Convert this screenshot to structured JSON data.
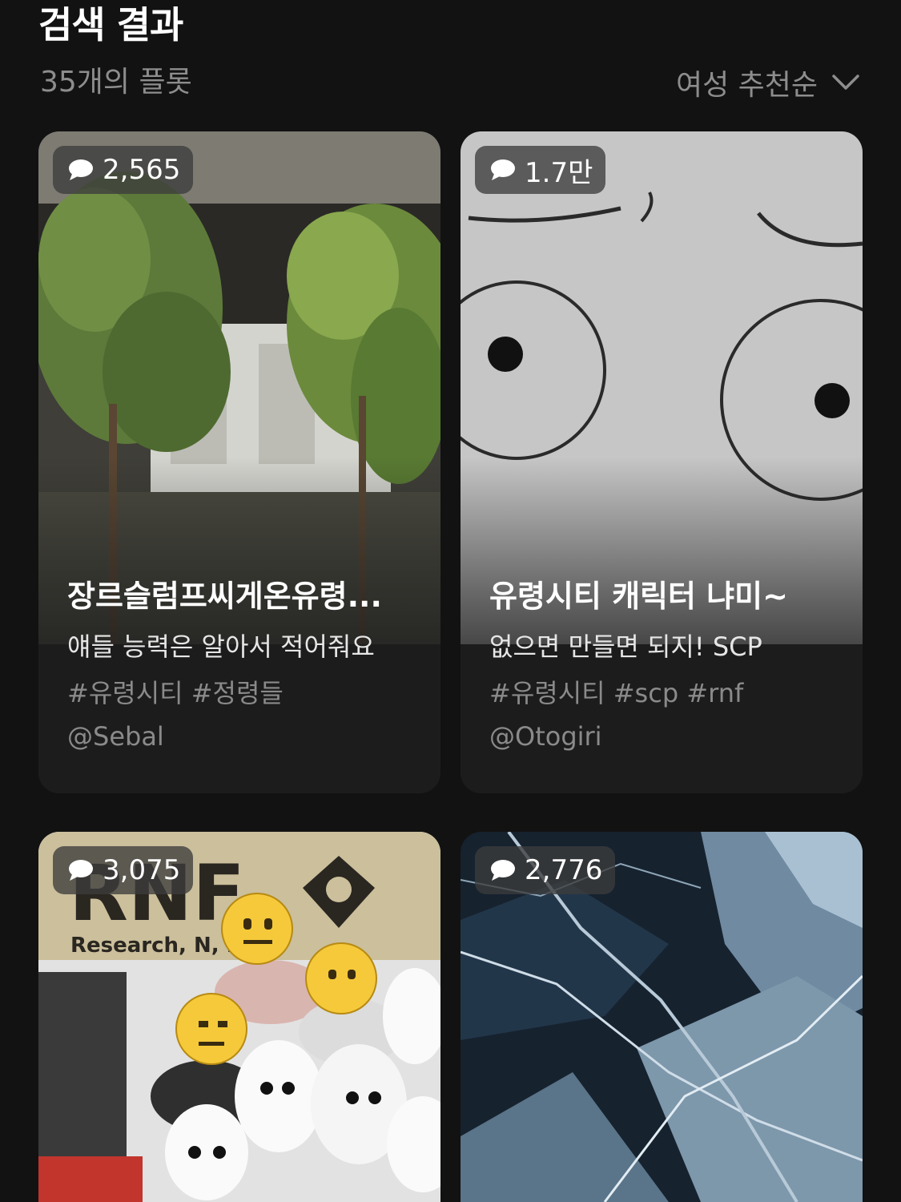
{
  "header": {
    "title": "검색 결과",
    "count": "35개의 플롯",
    "sort_label": "여성 추천순",
    "sort_icon": "chevron-down-icon"
  },
  "cards": [
    {
      "comments": "2,565",
      "title": "장르슬럼프씨게온유령...",
      "description": "얘들 능력은 알아서 적어줘요",
      "tags": "#유령시티 #정령들",
      "author": "@Sebal"
    },
    {
      "comments": "1.7만",
      "title": "유령시티 캐릭터 냐미~",
      "description": "없으면 만들면 되지! SCP",
      "tags": "#유령시티 #scp #rnf",
      "author": "@Otogiri"
    },
    {
      "comments": "3,075",
      "image_text": "RNF",
      "image_subtext": "Research, N, Filin"
    },
    {
      "comments": "2,776"
    }
  ],
  "colors": {
    "background": "#121212",
    "card": "#1c1c1c",
    "muted_text": "#8a8a8a"
  }
}
